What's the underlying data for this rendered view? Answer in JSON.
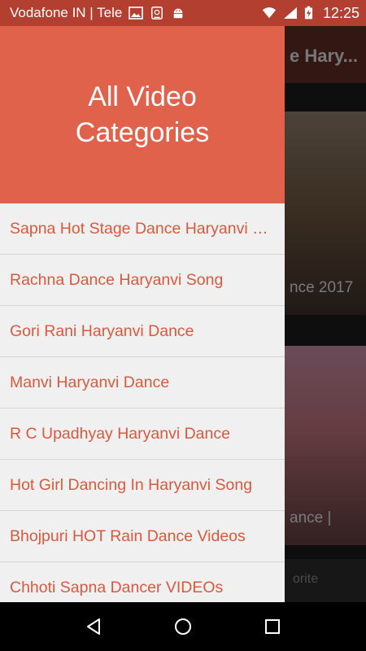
{
  "status_bar": {
    "carrier": "Vodafone IN | Tele",
    "time": "12:25",
    "icons": [
      "image-icon",
      "sim-card-icon",
      "android-icon",
      "wifi-icon",
      "signal-icon",
      "battery-charging-icon"
    ]
  },
  "background": {
    "toolbar_title_fragment": "e Hary...",
    "card1_caption_fragment": "nce 2017",
    "card2_caption_fragment": "ance |",
    "bottom_tab_fragment": "orite"
  },
  "drawer": {
    "title": "All Video Categories",
    "items": [
      {
        "label": "Sapna Hot Stage Dance Haryanvi Song"
      },
      {
        "label": "Rachna Dance Haryanvi Song"
      },
      {
        "label": "Gori Rani Haryanvi Dance"
      },
      {
        "label": "Manvi Haryanvi Dance"
      },
      {
        "label": "R C Upadhyay Haryanvi Dance"
      },
      {
        "label": "Hot Girl Dancing In Haryanvi Song"
      },
      {
        "label": "Bhojpuri HOT Rain Dance Videos"
      },
      {
        "label": "Chhoti Sapna Dancer VIDEOs"
      }
    ]
  },
  "colors": {
    "accent": "#e0624b",
    "item_text": "#d85a3e",
    "status_bar": "#b33f30"
  },
  "nav_bar": {
    "buttons": [
      "back-icon",
      "home-icon",
      "recents-icon"
    ]
  }
}
